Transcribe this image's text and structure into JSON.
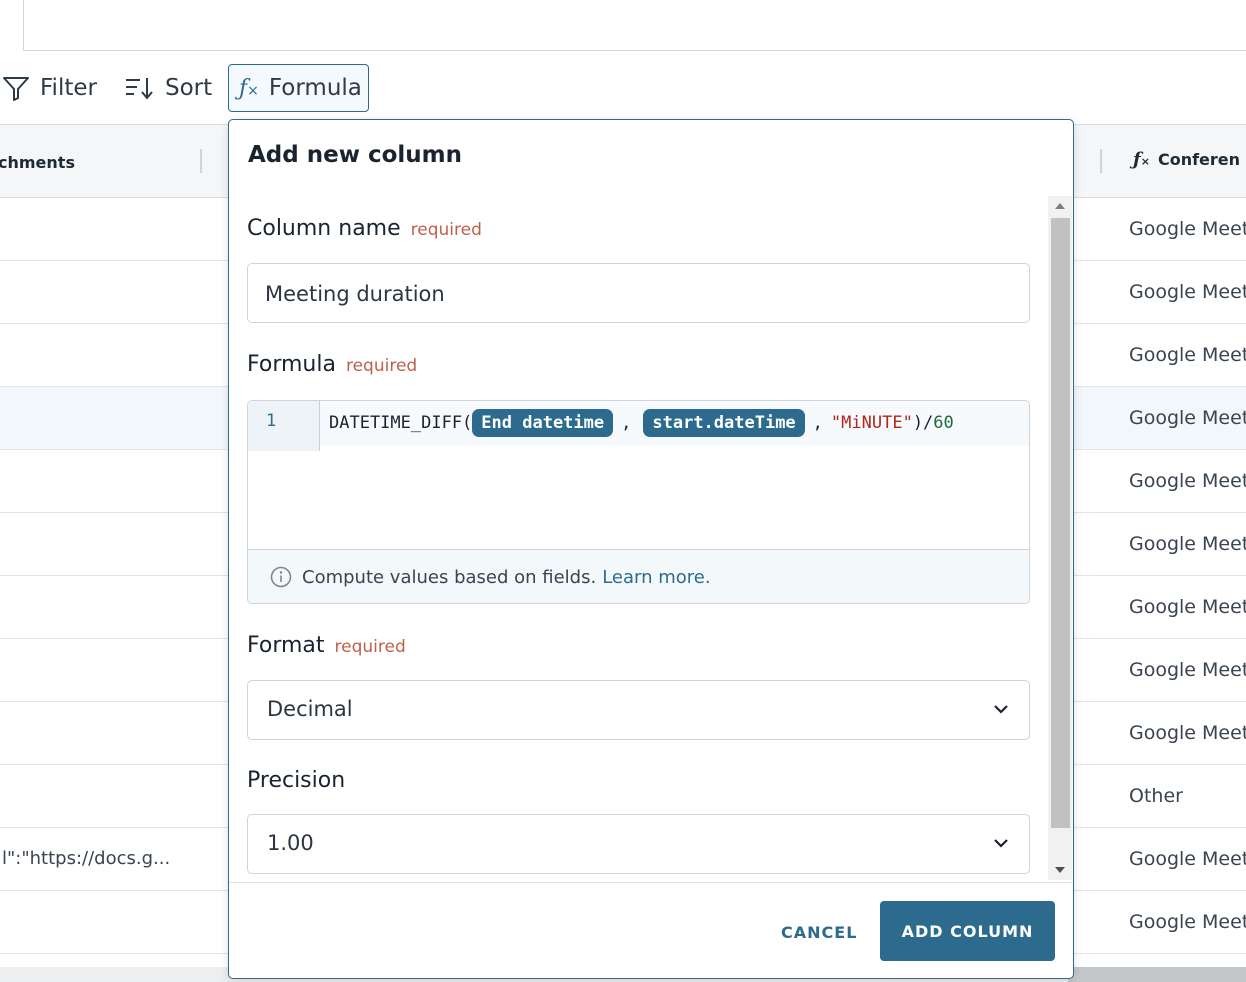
{
  "toolbar": {
    "filter_label": "Filter",
    "sort_label": "Sort",
    "formula_label": "Formula"
  },
  "table": {
    "headers": {
      "attachments": "chments",
      "conference": "Conferen"
    },
    "rows": [
      {
        "left": "",
        "conference": "Google Meet"
      },
      {
        "left": "",
        "conference": "Google Meet"
      },
      {
        "left": "",
        "conference": "Google Meet"
      },
      {
        "left": "",
        "conference": "Google Meet"
      },
      {
        "left": "",
        "conference": "Google Meet"
      },
      {
        "left": "",
        "conference": "Google Meet"
      },
      {
        "left": "",
        "conference": "Google Meet"
      },
      {
        "left": "",
        "conference": "Google Meet"
      },
      {
        "left": "",
        "conference": "Google Meet"
      },
      {
        "left": "",
        "conference": "Other"
      },
      {
        "left": "l\":\"https://docs.g...",
        "conference": "Google Meet"
      },
      {
        "left": "",
        "conference": "Google Meet"
      }
    ]
  },
  "modal": {
    "title": "Add new column",
    "column_name": {
      "label": "Column name",
      "required": "required",
      "value": "Meeting duration"
    },
    "formula": {
      "label": "Formula",
      "required": "required",
      "line_number": "1",
      "code_prefix": "DATETIME_DIFF(",
      "field1": "End datetime",
      "sep1": ",",
      "field2": "start.dateTime",
      "sep2": ",",
      "string_arg": "\"MiNUTE\"",
      "close": ")/",
      "divisor": "60",
      "hint": "Compute values based on fields.",
      "hint_link": "Learn more."
    },
    "format": {
      "label": "Format",
      "required": "required",
      "value": "Decimal"
    },
    "precision": {
      "label": "Precision",
      "value": "1.00"
    },
    "cancel_label": "CANCEL",
    "add_label": "ADD COLUMN"
  },
  "colors": {
    "accent": "#2c6b8e",
    "required": "#c0604a"
  }
}
